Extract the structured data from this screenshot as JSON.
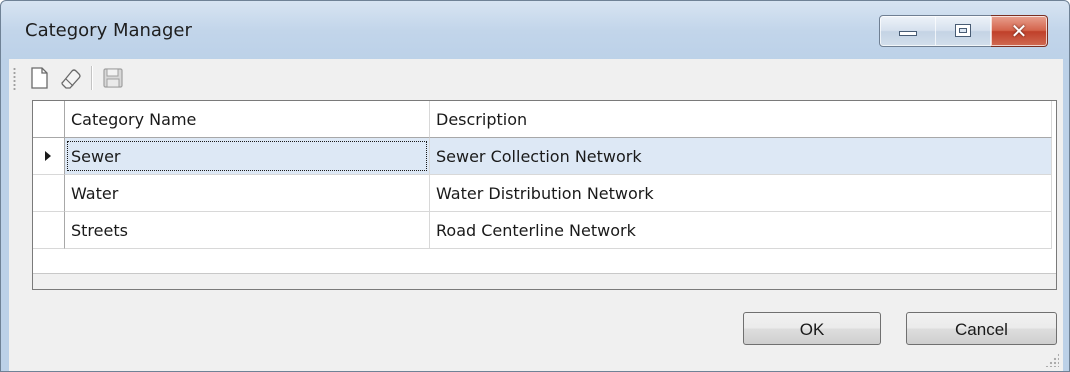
{
  "window": {
    "title": "Category Manager",
    "close_glyph": "✕"
  },
  "toolbar": {
    "buttons": [
      {
        "name": "new",
        "icon": "new-document-icon"
      },
      {
        "name": "erase",
        "icon": "eraser-icon"
      },
      {
        "name": "save",
        "icon": "save-icon",
        "enabled": false
      }
    ]
  },
  "grid": {
    "columns": [
      "Category Name",
      "Description"
    ],
    "current_row_index": 0,
    "rows": [
      {
        "name": "Sewer",
        "description": "Sewer Collection Network"
      },
      {
        "name": "Water",
        "description": "Water Distribution Network"
      },
      {
        "name": "Streets",
        "description": "Road Centerline Network"
      }
    ]
  },
  "buttons": {
    "ok": "OK",
    "cancel": "Cancel"
  },
  "colors": {
    "titlebar": "#c2d5ea",
    "close_button": "#c0402a",
    "selected_row": "#dde8f5"
  }
}
